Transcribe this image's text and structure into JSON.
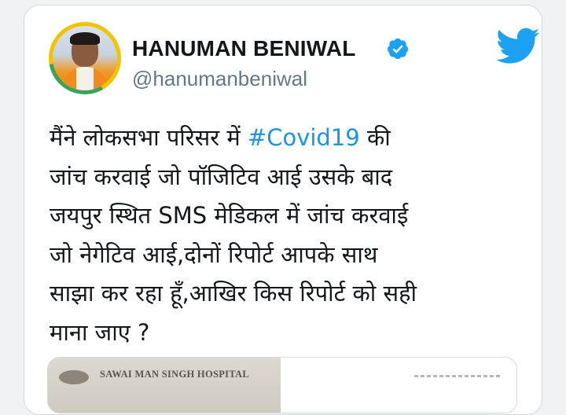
{
  "tweet": {
    "author_name": "HANUMAN BENIWAL",
    "author_handle": "@hanumanbeniwal",
    "text_before": "मैंने लोकसभा परिसर में ",
    "hashtag": "#Covid19",
    "text_after": " की\nजांच करवाई जो पॉजिटिव आई उसके बाद\nजयपुर स्थित SMS मेडिकल में जांच करवाई\nजो नेगेटिव आई,दोनों रिपोर्ट आपके साथ\nसाझा कर रहा हूँ,आखिर किस रिपोर्ट को सही\nमाना जाए ?",
    "media_caption": "SAWAI MAN SINGH HOSPITAL"
  },
  "icons": {
    "verified": "verified-badge-icon",
    "logo": "twitter-bird-icon"
  },
  "colors": {
    "text": "#14171a",
    "handle": "#657786",
    "hashtag": "#1b95e0",
    "twitter_blue": "#1da1f2",
    "avatar_ring_yellow": "#f2c300",
    "avatar_ring_green": "#3aa35a"
  }
}
